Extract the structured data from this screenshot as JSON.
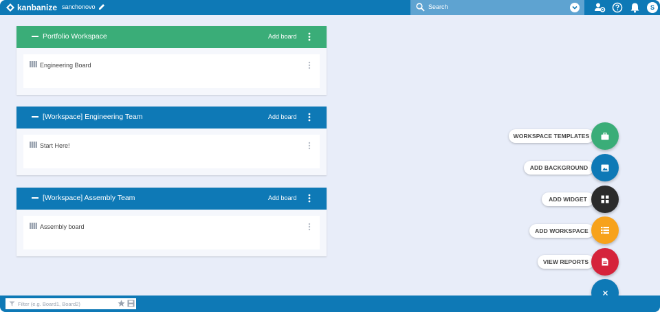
{
  "header": {
    "logo_text": "kanbanize",
    "username": "sanchonovo",
    "search_placeholder": "Search",
    "avatar_letter": "S"
  },
  "workspaces": [
    {
      "title": "Portfolio Workspace",
      "add_label": "Add board",
      "color": "#3aad78",
      "boards": [
        {
          "name": "Engineering Board"
        }
      ]
    },
    {
      "title": "[Workspace] Engineering Team",
      "add_label": "Add board",
      "color": "#0e79b6",
      "boards": [
        {
          "name": "Start Here!"
        }
      ]
    },
    {
      "title": "[Workspace] Assembly Team",
      "add_label": "Add board",
      "color": "#0e79b6",
      "boards": [
        {
          "name": "Assembly board"
        }
      ]
    }
  ],
  "speed_dial": {
    "actions": [
      {
        "label": "WORKSPACE TEMPLATES",
        "color": "#3aad78",
        "icon": "briefcase-icon"
      },
      {
        "label": "ADD BACKGROUND",
        "color": "#0e79b6",
        "icon": "image-icon"
      },
      {
        "label": "ADD WIDGET",
        "color": "#2b2b2b",
        "icon": "widget-icon"
      },
      {
        "label": "ADD WORKSPACE",
        "color": "#f7a21b",
        "icon": "list-icon"
      },
      {
        "label": "VIEW REPORTS",
        "color": "#d5233b",
        "icon": "report-icon"
      }
    ],
    "close_color": "#0e79b6",
    "close_icon": "close-icon"
  },
  "footer": {
    "filter_placeholder": "Filter (e.g. Board1, Board2)"
  }
}
